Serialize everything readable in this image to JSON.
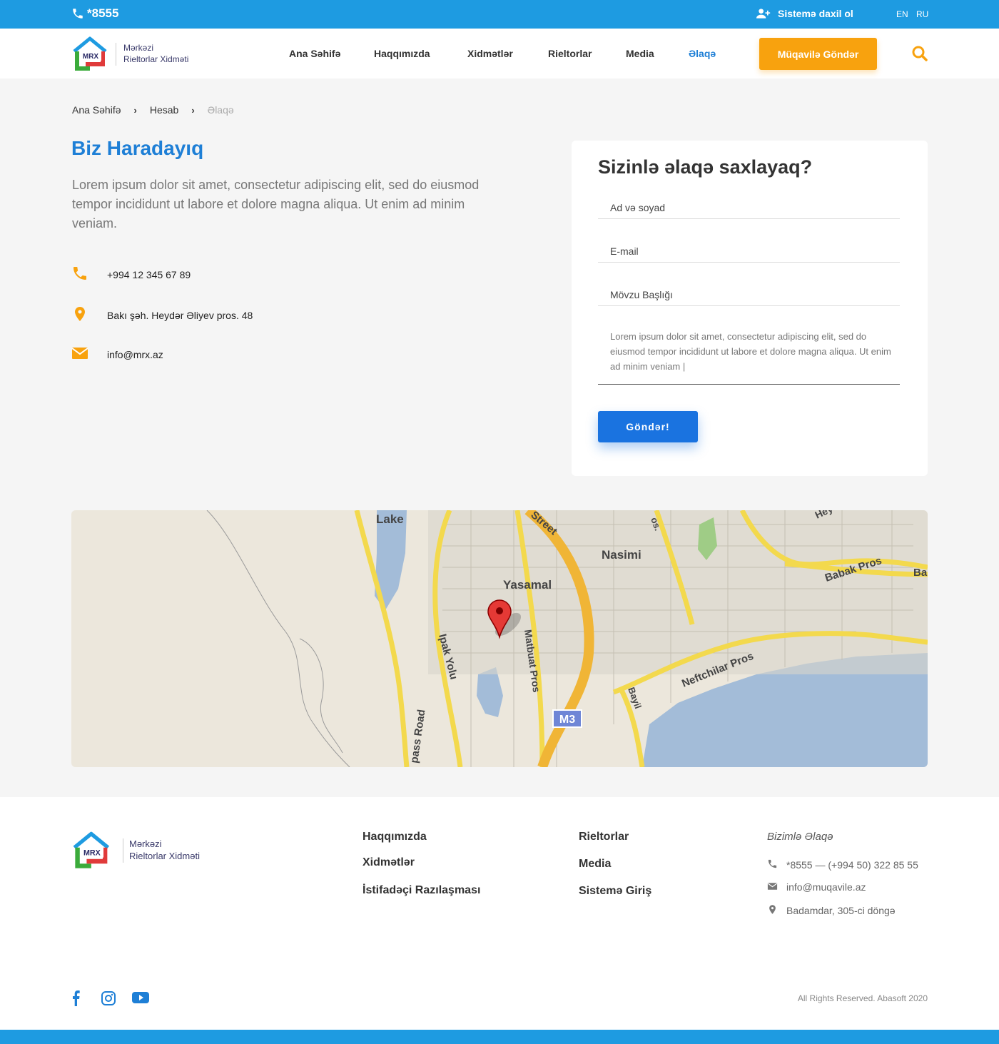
{
  "topbar": {
    "phone": "*8555",
    "login_label": "Sistemə daxil ol",
    "lang_en": "EN",
    "lang_ru": "RU"
  },
  "logo": {
    "mark": "MRX",
    "line1": "Mərkəzi",
    "line2": "Rieltorlar Xidməti"
  },
  "nav": {
    "items": [
      "Ana Səhifə",
      "Haqqımızda",
      "Xidmətlər",
      "Rieltorlar",
      "Media",
      "Əlaqə"
    ],
    "active_index": 5,
    "cta": "Müqavilə Göndər"
  },
  "breadcrumb": [
    "Ana Səhifə",
    "Hesab",
    "Əlaqə"
  ],
  "page": {
    "title": "Biz Haradayıq",
    "lead": "Lorem ipsum dolor sit amet, consectetur adipiscing elit, sed do eiusmod tempor incididunt ut labore et dolore magna aliqua. Ut enim ad minim veniam.",
    "contacts": {
      "phone": "+994 12 345 67 89",
      "address": "Bakı şəh. Heydər Əliyev pros. 48",
      "email": "info@mrx.az"
    }
  },
  "form": {
    "title": "Sizinlə əlaqə saxlayaq?",
    "name_placeholder": "Ad və soyad",
    "email_placeholder": "E-mail",
    "subject_placeholder": "Mövzu Başlığı",
    "message_value": "Lorem ipsum dolor sit amet, consectetur adipiscing elit, sed do eiusmod tempor incididunt ut labore et dolore magna aliqua. Ut enim ad minim veniam |",
    "submit": "Göndər!"
  },
  "map": {
    "labels": {
      "lake": "Lake",
      "street": "Street",
      "nasimi": "Nasimi",
      "yasamal": "Yasamal",
      "babak": "Babak Pros",
      "ba": "Ba",
      "ipak": "Ipak Yolu",
      "matbuat": "Matbuat Pros",
      "neftchilar": "Neftchilar Pros",
      "bypass": "pass Road",
      "m3": "M3",
      "bayil": "Bayil",
      "heyd": "Hey",
      "os": "os."
    }
  },
  "footer": {
    "col1": [
      "Haqqımızda",
      "Xidmətlər",
      "İstifadəçi Razılaşması"
    ],
    "col2": [
      "Rieltorlar",
      "Media",
      "Sistemə Giriş"
    ],
    "contact_heading": "Bizimlə Əlaqə",
    "phone": "*8555 — (+994 50) 322 85 55",
    "email": "info@muqavile.az",
    "address": "Badamdar, 305-ci döngə",
    "copyright": "All Rights Reserved. Abasoft 2020"
  },
  "colors": {
    "brand_blue": "#1e9be1",
    "link_blue": "#1e7fd6",
    "accent_orange": "#f8a20e",
    "button_blue": "#1a73e0"
  }
}
